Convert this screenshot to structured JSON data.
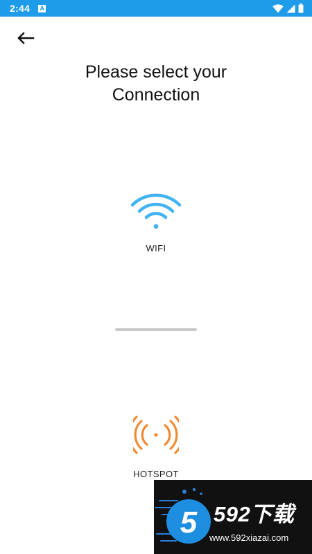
{
  "status_bar": {
    "time": "2:44",
    "notification_glyph": "A",
    "icons": [
      "wifi-icon",
      "cell-signal-icon",
      "battery-icon"
    ],
    "color": "#1e9be9"
  },
  "header": {
    "back_icon": "arrow-left-icon",
    "title_line1": "Please select your",
    "title_line2": "Connection"
  },
  "options": [
    {
      "label": "WIFI",
      "icon": "wifi-icon",
      "color": "#42b3f2"
    },
    {
      "label": "HOTSPOT",
      "icon": "hotspot-icon",
      "color": "#f18a32"
    }
  ],
  "watermark": {
    "brand": "592下载",
    "logo_digit": "5",
    "url": "www.592xiazai.com",
    "logo_color": "#1e8fe0"
  }
}
